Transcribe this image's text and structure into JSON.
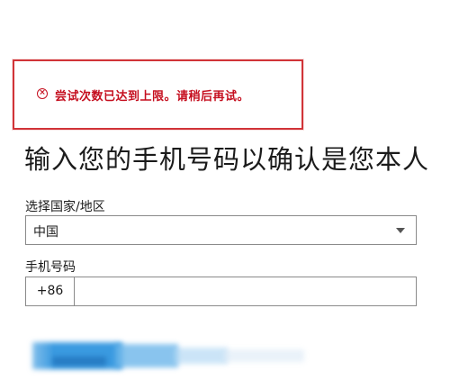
{
  "error": {
    "icon": "error-circle-icon",
    "message": "尝试次数已达到上限。请稍后再试。",
    "color": "#c50f1f"
  },
  "title": "输入您的手机号码以确认是您本人",
  "country": {
    "label": "选择国家/地区",
    "selected": "中国"
  },
  "phone": {
    "label": "手机号码",
    "prefix": "+86",
    "value": ""
  },
  "colors": {
    "error_border": "#d13438",
    "input_border": "#8a8a8a",
    "blurred_button": "#2b88d8"
  }
}
